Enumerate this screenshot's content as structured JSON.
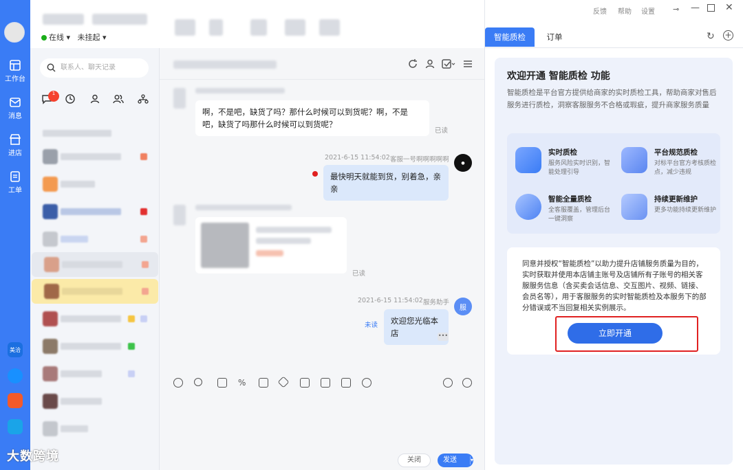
{
  "window": {
    "links": [
      "反馈",
      "帮助",
      "设置"
    ],
    "status_label": "在线",
    "hangup_label": "未挂起"
  },
  "rail": {
    "nav": [
      {
        "label": "工作台",
        "icon": "workbench-icon"
      },
      {
        "label": "消息",
        "icon": "message-icon"
      },
      {
        "label": "进店",
        "icon": "store-icon"
      },
      {
        "label": "工单",
        "icon": "ticket-icon"
      }
    ],
    "apps": [
      {
        "label": "美洽",
        "color": "#1b6fe0"
      },
      {
        "label": "",
        "color": "#1890ff"
      },
      {
        "label": "",
        "color": "#f35a2a"
      },
      {
        "label": "",
        "color": "#1aa4e8"
      }
    ]
  },
  "conv": {
    "search_placeholder": "联系人、聊天记录",
    "badge_count": "1"
  },
  "chat": {
    "messages": [
      {
        "side": "left",
        "text": "啊，不是吧，缺货了吗？那什么时候可以到货呢？啊，不是吧，缺货了吗那什么时候可以到货呢？",
        "status": "已读"
      },
      {
        "side": "right",
        "time": "2021-6-15 11:54:02",
        "sender": "客服一号啊啊啊啊啊",
        "text": "最快明天就能到货，别着急，亲亲"
      },
      {
        "side": "left",
        "type": "card",
        "status": "已读"
      },
      {
        "side": "right",
        "time": "2021-6-15 11:54:02",
        "sender": "服务助手",
        "text": "欢迎您光临本店",
        "status": "未读",
        "avatar_text": "服"
      }
    ],
    "close_label": "关闭",
    "send_label": "发送"
  },
  "panel": {
    "tabs": [
      "智能质检",
      "订单"
    ],
    "title": "欢迎开通 智能质检 功能",
    "desc": "智能质检是平台官方提供给商家的实时质检工具，帮助商家对售后服务进行质检，洞察客服服务不合格或瑕疵，提升商家服务质量",
    "features": [
      {
        "title": "实时质检",
        "desc": "服务风险实时识别，智能处理引导"
      },
      {
        "title": "平台规范质检",
        "desc": "对标平台官方考核质检点，减少违规"
      },
      {
        "title": "智能全量质检",
        "desc": "全客服覆盖，管理后台一键洞察"
      },
      {
        "title": "持续更新维护",
        "desc": "更多功能持续更新维护"
      }
    ],
    "agreement": "同意并授权“智能质检”以助力提升店铺服务质量为目的，实时获取并使用本店铺主账号及店铺所有子账号的相关客服服务信息（含买卖会话信息、交互图片、视频、链接、会员名等），用于客服服务的实时智能质检及本服务下的部分错误或不当回复相关实例展示。",
    "open_button": "立即开通"
  },
  "watermark": "大数跨境"
}
